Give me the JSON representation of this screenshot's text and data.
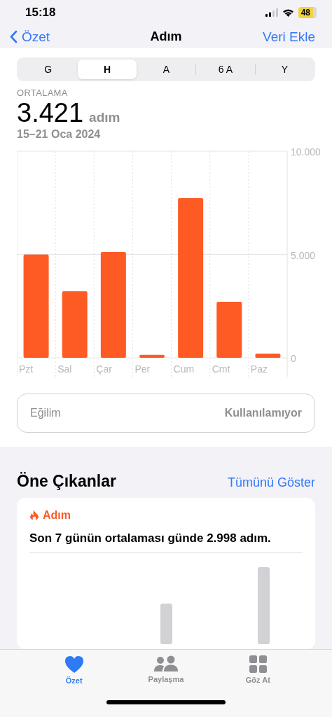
{
  "status_bar": {
    "time": "15:18",
    "battery": "48"
  },
  "nav": {
    "back": "Özet",
    "title": "Adım",
    "action": "Veri Ekle"
  },
  "ranges": [
    {
      "label": "G",
      "selected": false
    },
    {
      "label": "H",
      "selected": true
    },
    {
      "label": "A",
      "selected": false
    },
    {
      "label": "6 A",
      "selected": false
    },
    {
      "label": "Y",
      "selected": false
    }
  ],
  "summary": {
    "label": "ORTALAMA",
    "value": "3.421",
    "unit": "adım",
    "period": "15–21 Oca 2024"
  },
  "chart": {
    "chart_data": {
      "type": "bar",
      "categories": [
        "Pzt",
        "Sal",
        "Çar",
        "Per",
        "Cum",
        "Cmt",
        "Paz"
      ],
      "series": [
        {
          "color": "#fe5b24",
          "values": [
            5000,
            3220,
            5120,
            140,
            7730,
            2710,
            200
          ]
        }
      ],
      "ylim": [
        0,
        10000
      ],
      "yticks": [
        0,
        {
          "value": 5000,
          "label": "5.000"
        },
        {
          "value": 10000,
          "label": "10.000"
        }
      ]
    }
  },
  "trend": {
    "label": "Eğilim",
    "value": "Kullanılamıyor"
  },
  "highlights": {
    "title": "Öne Çıkanlar",
    "link": "Tümünü Göster",
    "card": {
      "category": "Adım",
      "text": "Son 7 günün ortalaması günde 2.998 adım."
    }
  },
  "tab_bar": [
    {
      "label": "Özet",
      "kind": "heart",
      "selected": true
    },
    {
      "label": "Paylaşma",
      "kind": "people",
      "selected": false
    },
    {
      "label": "Göz At",
      "kind": "grid",
      "selected": false
    }
  ]
}
